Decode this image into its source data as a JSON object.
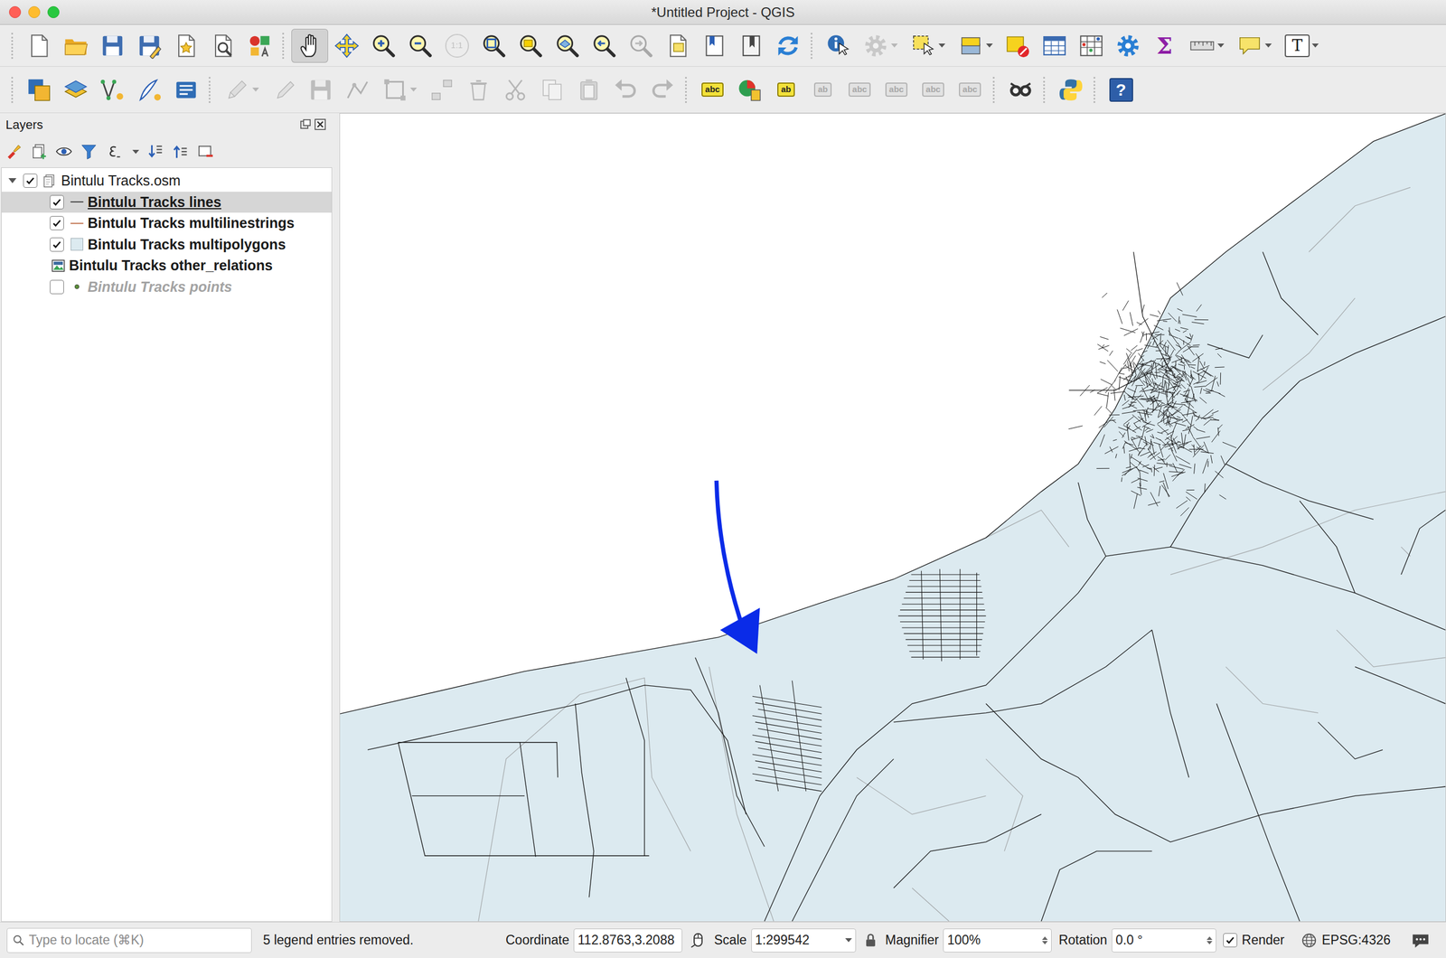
{
  "window": {
    "title": "*Untitled Project - QGIS"
  },
  "toolbars": [
    {
      "groups": [
        [
          {
            "kind": "icon",
            "selected": false,
            "disabled": false,
            "has_menu": false
          },
          {
            "kind": "icon",
            "selected": false,
            "disabled": false,
            "has_menu": false
          },
          {
            "kind": "icon",
            "selected": false,
            "disabled": false,
            "has_menu": false
          },
          {
            "kind": "icon",
            "selected": false,
            "disabled": false,
            "has_menu": false
          },
          {
            "kind": "icon",
            "selected": false,
            "disabled": false,
            "has_menu": false
          },
          {
            "kind": "icon",
            "selected": false,
            "disabled": false,
            "has_menu": false
          },
          {
            "kind": "icon",
            "selected": false,
            "disabled": false,
            "has_menu": false
          }
        ],
        [
          {
            "kind": "icon",
            "selected": true,
            "disabled": false,
            "has_menu": false
          },
          {
            "kind": "icon",
            "selected": false,
            "disabled": false,
            "has_menu": false
          },
          {
            "kind": "icon",
            "selected": false,
            "disabled": false,
            "has_menu": false
          },
          {
            "kind": "icon",
            "selected": false,
            "disabled": false,
            "has_menu": false
          },
          {
            "kind": "scale",
            "glyph": "1:1",
            "selected": false,
            "disabled": true,
            "has_menu": false
          },
          {
            "kind": "icon",
            "selected": false,
            "disabled": false,
            "has_menu": false
          },
          {
            "kind": "icon",
            "selected": false,
            "disabled": false,
            "has_menu": false
          },
          {
            "kind": "icon",
            "selected": false,
            "disabled": false,
            "has_menu": false
          },
          {
            "kind": "icon",
            "selected": false,
            "disabled": false,
            "has_menu": false
          },
          {
            "kind": "icon",
            "selected": false,
            "disabled": true,
            "has_menu": false
          },
          {
            "kind": "icon",
            "selected": false,
            "disabled": false,
            "has_menu": false
          },
          {
            "kind": "icon",
            "selected": false,
            "disabled": false,
            "has_menu": false
          },
          {
            "kind": "icon",
            "selected": false,
            "disabled": false,
            "has_menu": false
          },
          {
            "kind": "icon",
            "selected": false,
            "disabled": false,
            "has_menu": false
          }
        ],
        [
          {
            "kind": "icon",
            "selected": false,
            "disabled": false,
            "has_menu": false
          },
          {
            "kind": "icon",
            "selected": false,
            "disabled": true,
            "has_menu": true
          },
          {
            "kind": "icon",
            "selected": false,
            "disabled": false,
            "has_menu": true
          },
          {
            "kind": "icon",
            "selected": false,
            "disabled": false,
            "has_menu": true
          },
          {
            "kind": "icon",
            "selected": false,
            "disabled": false,
            "has_menu": false
          },
          {
            "kind": "icon",
            "selected": false,
            "disabled": false,
            "has_menu": false
          },
          {
            "kind": "icon",
            "selected": false,
            "disabled": false,
            "has_menu": false
          },
          {
            "kind": "icon",
            "selected": false,
            "disabled": false,
            "has_menu": false
          },
          {
            "kind": "sum",
            "glyph": "Σ",
            "selected": false,
            "disabled": false,
            "has_menu": false
          },
          {
            "kind": "icon",
            "selected": false,
            "disabled": false,
            "has_menu": true
          },
          {
            "kind": "icon",
            "selected": false,
            "disabled": false,
            "has_menu": true
          },
          {
            "kind": "text",
            "glyph": "T",
            "selected": false,
            "disabled": false,
            "has_menu": true
          }
        ]
      ]
    },
    {
      "groups": [
        [
          {
            "kind": "icon",
            "selected": false,
            "disabled": false,
            "has_menu": false
          },
          {
            "kind": "icon",
            "selected": false,
            "disabled": false,
            "has_menu": false
          },
          {
            "kind": "icon",
            "selected": false,
            "disabled": false,
            "has_menu": false
          },
          {
            "kind": "icon",
            "selected": false,
            "disabled": false,
            "has_menu": false
          },
          {
            "kind": "icon",
            "selected": false,
            "disabled": false,
            "has_menu": false
          }
        ],
        [
          {
            "kind": "icon",
            "selected": false,
            "disabled": true,
            "has_menu": true
          },
          {
            "kind": "icon",
            "selected": false,
            "disabled": true,
            "has_menu": false
          },
          {
            "kind": "icon",
            "selected": false,
            "disabled": true,
            "has_menu": false
          },
          {
            "kind": "icon",
            "selected": false,
            "disabled": true,
            "has_menu": false
          },
          {
            "kind": "icon",
            "selected": false,
            "disabled": true,
            "has_menu": true
          },
          {
            "kind": "icon",
            "selected": false,
            "disabled": true,
            "has_menu": false
          },
          {
            "kind": "icon",
            "selected": false,
            "disabled": true,
            "has_menu": false
          },
          {
            "kind": "icon",
            "selected": false,
            "disabled": true,
            "has_menu": false
          },
          {
            "kind": "icon",
            "selected": false,
            "disabled": true,
            "has_menu": false
          },
          {
            "kind": "icon",
            "selected": false,
            "disabled": true,
            "has_menu": false
          },
          {
            "kind": "icon",
            "selected": false,
            "disabled": true,
            "has_menu": false
          },
          {
            "kind": "icon",
            "selected": false,
            "disabled": true,
            "has_menu": false
          }
        ],
        [
          {
            "kind": "label",
            "glyph": "abc",
            "selected": false,
            "disabled": false,
            "has_menu": false
          },
          {
            "kind": "icon",
            "selected": false,
            "disabled": false,
            "has_menu": false
          },
          {
            "kind": "label",
            "glyph": "ab",
            "selected": false,
            "disabled": false,
            "has_menu": false
          },
          {
            "kind": "label",
            "glyph": "ab",
            "selected": false,
            "disabled": true,
            "has_menu": false
          },
          {
            "kind": "label",
            "glyph": "abc",
            "selected": false,
            "disabled": true,
            "has_menu": false
          },
          {
            "kind": "label",
            "glyph": "abc",
            "selected": false,
            "disabled": true,
            "has_menu": false
          },
          {
            "kind": "label",
            "glyph": "abc",
            "selected": false,
            "disabled": true,
            "has_menu": false
          },
          {
            "kind": "label",
            "glyph": "abc",
            "selected": false,
            "disabled": true,
            "has_menu": false
          }
        ],
        [
          {
            "kind": "icon",
            "selected": false,
            "disabled": false,
            "has_menu": false
          }
        ],
        [
          {
            "kind": "icon",
            "selected": false,
            "disabled": false,
            "has_menu": false
          }
        ],
        [
          {
            "kind": "help",
            "glyph": "?",
            "selected": false,
            "disabled": false,
            "has_menu": false
          }
        ]
      ]
    }
  ],
  "layers_panel": {
    "title": "Layers",
    "tree": {
      "label": "Bintulu Tracks.osm",
      "checked": true,
      "expanded": true,
      "selected": false,
      "children": [
        {
          "label": "Bintulu Tracks lines",
          "kind": "line",
          "checkable": true,
          "checked": true,
          "selected": true,
          "color": "#4a4a4a"
        },
        {
          "label": "Bintulu Tracks multilinestrings",
          "kind": "line",
          "checkable": true,
          "checked": true,
          "selected": false,
          "color": "#c47a58"
        },
        {
          "label": "Bintulu Tracks multipolygons",
          "kind": "polygon",
          "checkable": true,
          "checked": true,
          "selected": false,
          "color": "#dceaf0"
        },
        {
          "label": "Bintulu Tracks other_relations",
          "kind": "raster",
          "checkable": false,
          "checked": false,
          "selected": false,
          "color": "#3b6a9e"
        },
        {
          "label": "Bintulu Tracks points",
          "kind": "point",
          "checkable": true,
          "checked": false,
          "selected": false,
          "color": "#5c8f3a"
        }
      ]
    }
  },
  "status_bar": {
    "search": {
      "placeholder": "Type to locate (⌘K)"
    },
    "message": "5 legend entries removed.",
    "coordinate": {
      "label": "Coordinate",
      "value": "112.8763,3.2088"
    },
    "scale": {
      "label": "Scale",
      "value": "1:299542"
    },
    "magnifier": {
      "label": "Magnifier",
      "value": "100%"
    },
    "rotation": {
      "label": "Rotation",
      "value": "0.0 °"
    },
    "render": {
      "label": "Render",
      "checked": true
    },
    "crs": "EPSG:4326"
  }
}
